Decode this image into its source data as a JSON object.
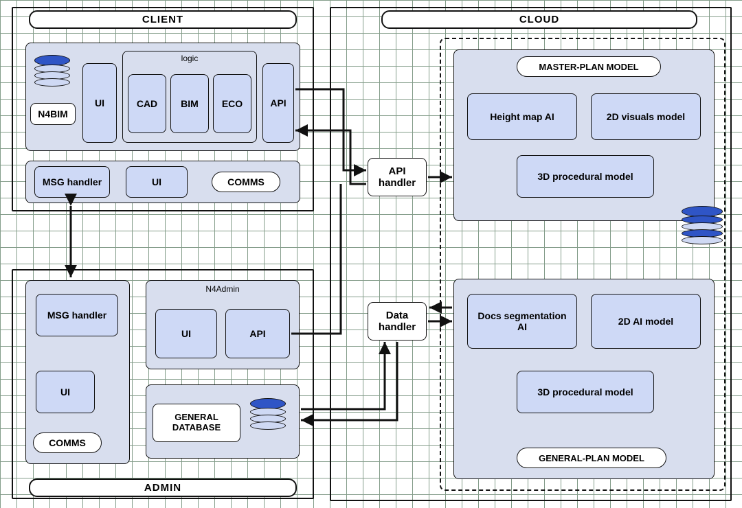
{
  "zones": {
    "client": "CLIENT",
    "admin": "ADMIN",
    "cloud": "CLOUD"
  },
  "client": {
    "n4bim": "N4BIM",
    "ui": "UI",
    "logic_label": "logic",
    "cad": "CAD",
    "bim": "BIM",
    "eco": "ECO",
    "api": "API",
    "msg_handler": "MSG handler",
    "comm_ui": "UI",
    "comms": "COMMS"
  },
  "admin": {
    "msg_handler": "MSG handler",
    "ui": "UI",
    "comms": "COMMS",
    "n4admin_label": "N4Admin",
    "n4admin_ui": "UI",
    "n4admin_api": "API",
    "general_db": "GENERAL DATABASE"
  },
  "middle": {
    "api_handler": "API handler",
    "data_handler": "Data handler"
  },
  "cloud": {
    "master_title": "MASTER-PLAN MODEL",
    "master": {
      "heightmap": "Height map AI",
      "visuals2d": "2D visuals model",
      "proc3d": "3D procedural model"
    },
    "general_title": "GENERAL-PLAN MODEL",
    "general": {
      "docs_ai": "Docs segmentation AI",
      "ai2d": "2D AI model",
      "proc3d": "3D procedural model"
    }
  }
}
